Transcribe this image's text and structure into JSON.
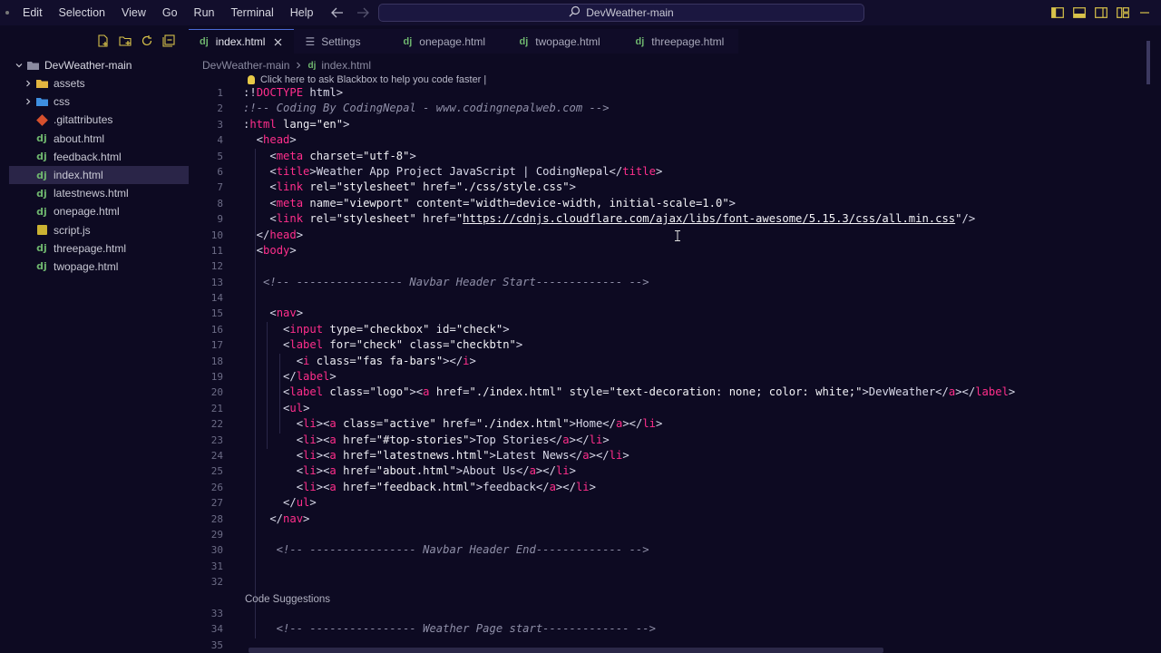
{
  "menu": [
    "Edit",
    "Selection",
    "View",
    "Go",
    "Run",
    "Terminal",
    "Help"
  ],
  "command_center": {
    "label": "DevWeather-main",
    "icon": "search-icon"
  },
  "explorer": {
    "root": "DevWeather-main",
    "items": [
      {
        "name": "assets",
        "kind": "folder"
      },
      {
        "name": "css",
        "kind": "folder"
      },
      {
        "name": ".gitattributes",
        "kind": "git"
      },
      {
        "name": "about.html",
        "kind": "dj"
      },
      {
        "name": "feedback.html",
        "kind": "dj"
      },
      {
        "name": "index.html",
        "kind": "dj",
        "active": true
      },
      {
        "name": "latestnews.html",
        "kind": "dj"
      },
      {
        "name": "onepage.html",
        "kind": "dj"
      },
      {
        "name": "script.js",
        "kind": "js"
      },
      {
        "name": "threepage.html",
        "kind": "dj"
      },
      {
        "name": "twopage.html",
        "kind": "dj"
      }
    ]
  },
  "tabs": [
    {
      "label": "index.html",
      "active": true
    },
    {
      "label": "Settings"
    },
    {
      "label": "onepage.html"
    },
    {
      "label": "twopage.html"
    },
    {
      "label": "threepage.html"
    }
  ],
  "breadcrumb": {
    "folder": "DevWeather-main",
    "file": "index.html"
  },
  "hint_text": "Click here to ask Blackbox to help you code faster |",
  "code_suggestions_label": "Code Suggestions",
  "line_numbers": [
    "1",
    "2",
    "3",
    "4",
    "5",
    "6",
    "7",
    "8",
    "9",
    "10",
    "11",
    "12",
    "13",
    "14",
    "15",
    "16",
    "17",
    "18",
    "19",
    "20",
    "21",
    "22",
    "23",
    "24",
    "25",
    "26",
    "27",
    "28",
    "29",
    "30",
    "31",
    "32",
    "",
    "33",
    "34",
    "35"
  ],
  "colors": {
    "tag": "#ff2e8b",
    "comment": "#8f8fa8",
    "background": "#0d0a22",
    "accent": "#4b6bd6"
  }
}
